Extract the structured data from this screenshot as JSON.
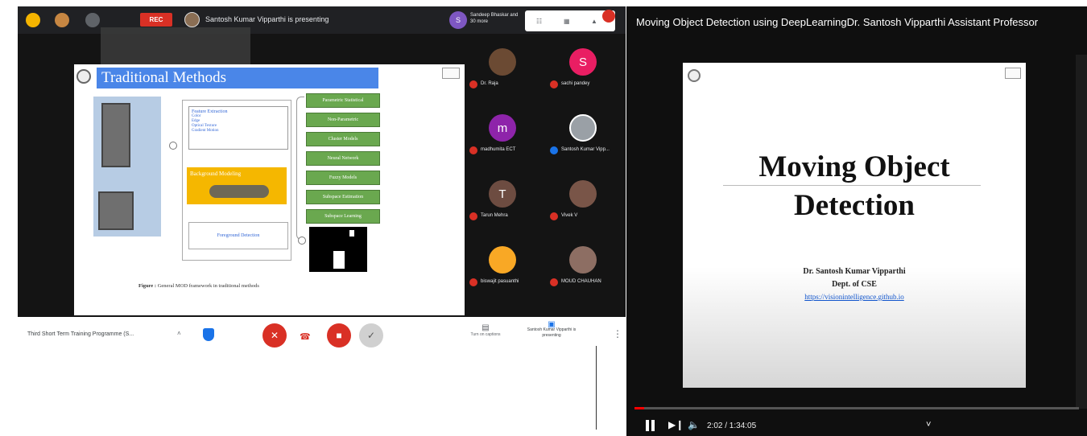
{
  "meet": {
    "rec_label": "REC",
    "presenting_text": "Santosh Kumar Vipparthi is presenting",
    "joiner_text": "Sandeep Bhaskar and 30 more",
    "slide": {
      "title": "Traditional Methods",
      "feature_heading": "Feature Extraction",
      "feature_items": [
        "Color",
        "Edge",
        "Optical Texture",
        "Gradient Motion"
      ],
      "background_label": "Background Modeling",
      "foreground_label": "Foreground Detection",
      "methods": [
        "Parametric Statistical",
        "Non-Parametric",
        "Cluster Models",
        "Neural Network",
        "Fuzzy Models",
        "Subspace Estimation",
        "Subspace Learning"
      ],
      "caption_bold": "Figure :",
      "caption_text": "General MOD framework in traditional methods"
    },
    "participants": [
      {
        "name": "Dr. Raja",
        "initial": "",
        "color": "#6b4a33"
      },
      {
        "name": "sachi pandey",
        "initial": "S",
        "color": "#e91e63"
      },
      {
        "name": "madhumita ECT",
        "initial": "m",
        "color": "#8e24aa"
      },
      {
        "name": "Santosh Kumar Vipp...",
        "initial": "",
        "color": "#9aa0a6"
      },
      {
        "name": "Tarun Mehra",
        "initial": "T",
        "color": "#6d4c41"
      },
      {
        "name": "Vivek V",
        "initial": "",
        "color": "#795548"
      },
      {
        "name": "biswajit pasuanthi",
        "initial": "",
        "color": "#f9a825"
      },
      {
        "name": "MOUD CHAUHAN",
        "initial": "",
        "color": "#8d6e63"
      }
    ],
    "meeting_title": "Third Short Term Training Programme (S...",
    "captions_label": "Turn on captions",
    "presenting_btn_label": "Santosh Kumar Vipparthi is presenting"
  },
  "youtube": {
    "title": "Moving Object Detection using DeepLearningDr. Santosh Vipparthi Assistant Professor",
    "slide_title_line1": "Moving Object",
    "slide_title_line2": "Detection",
    "author": "Dr. Santosh Kumar Vipparthi",
    "dept": "Dept. of CSE",
    "link": "https://visionintelligence.github.io",
    "time": "2:02 / 1:34:05",
    "progress_fraction": 0.022
  }
}
